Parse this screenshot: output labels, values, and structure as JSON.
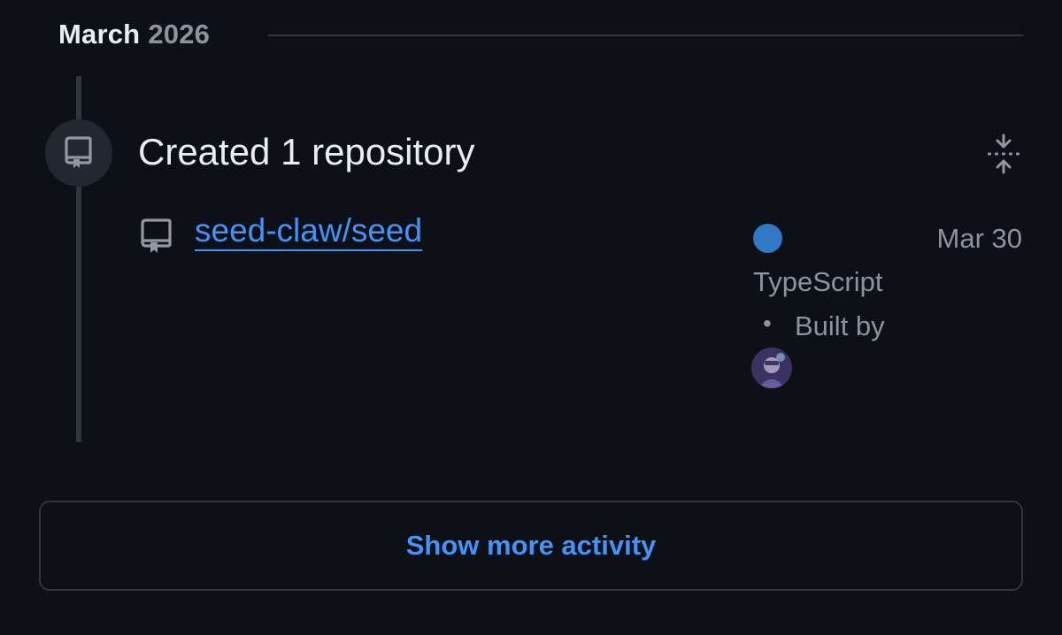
{
  "activity": {
    "month": "March",
    "year": "2026",
    "section_title": "Created 1 repository",
    "repo": {
      "name": "seed-claw/seed",
      "date": "Mar 30",
      "language": "TypeScript",
      "language_color": "#3178c6",
      "separator": "•",
      "built_by_label": "Built by"
    },
    "show_more_label": "Show more activity"
  },
  "icons": {
    "timeline_badge": "repo-icon",
    "collapse": "fold-icon",
    "repo_row": "repo-icon"
  },
  "colors": {
    "background": "#0d1117",
    "link": "#4493f8",
    "muted": "#8b949e",
    "border": "#30363d"
  }
}
